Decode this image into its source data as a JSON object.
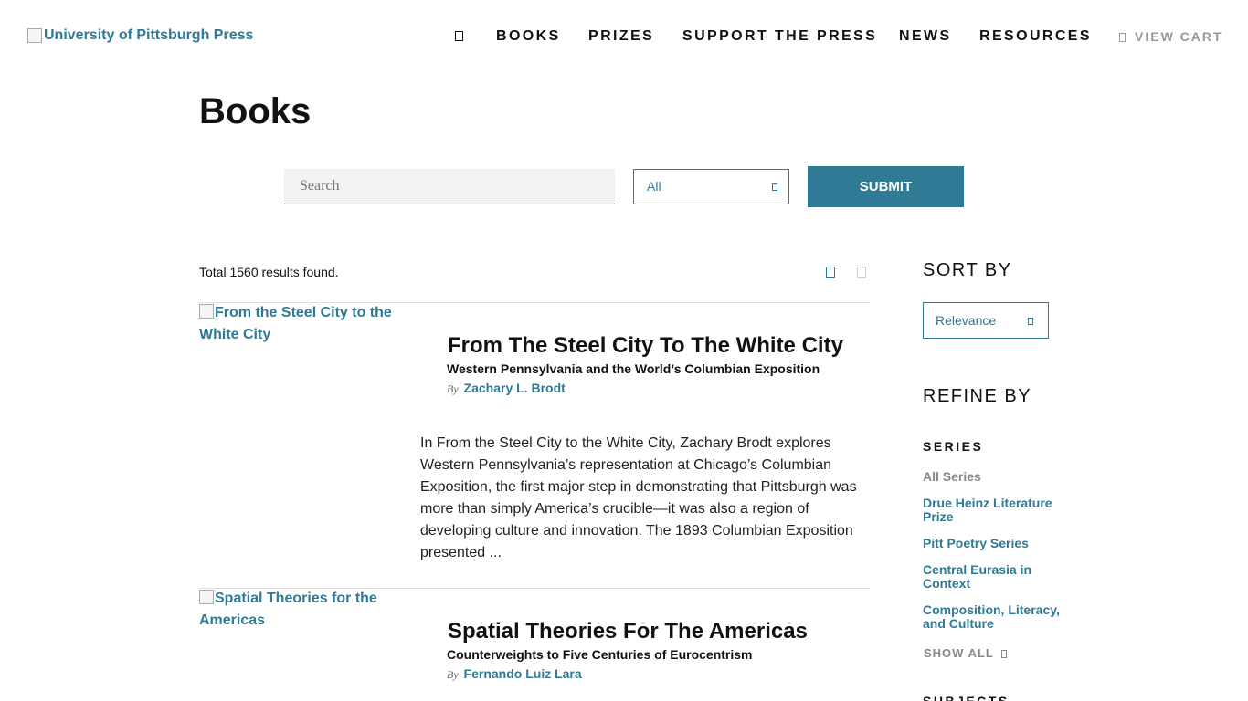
{
  "header": {
    "logo_alt": "University of Pittsburgh Press",
    "nav": {
      "search_icon": "search-icon",
      "items": [
        "Books",
        "Prizes",
        "Support the Press",
        "News",
        "Resources"
      ],
      "cart_label": "View Cart",
      "cart_icon": "cart-icon"
    }
  },
  "page": {
    "title": "Books"
  },
  "search": {
    "placeholder": "Search",
    "value": "",
    "type_select": "All",
    "submit_label": "SUBMIT"
  },
  "results": {
    "total_text": "Total 1560 results found.",
    "view_icons": [
      "list-view-icon",
      "grid-view-icon"
    ],
    "books": [
      {
        "image_alt": "From the Steel City to the White City",
        "title": "From The Steel City To The White City",
        "subtitle": "Western Pennsylvania and the World’s Columbian Exposition",
        "by": "By",
        "author": "Zachary L. Brodt",
        "description": "In From the Steel City to the White City, Zachary Brodt explores Western Pennsylvania’s representation at Chicago’s Columbian Exposition, the first major step in demonstrating that Pittsburgh was more than simply America’s crucible—it was also a region of developing culture and innovation. The 1893 Columbian Exposition presented ..."
      },
      {
        "image_alt": "Spatial Theories for the Americas",
        "title": "Spatial Theories For The Americas",
        "subtitle": "Counterweights to Five Centuries of Eurocentrism",
        "by": "By",
        "author": "Fernando Luiz Lara"
      }
    ]
  },
  "sidebar": {
    "sort_heading": "SORT BY",
    "sort_value": "Relevance",
    "refine_heading": "REFINE BY",
    "series_heading": "SERIES",
    "series": [
      "All Series",
      "Drue Heinz Literature Prize",
      "Pitt Poetry Series",
      "Central Eurasia in Context",
      "Composition, Literacy, and Culture"
    ],
    "show_all_label": "SHOW ALL",
    "subjects_heading": "SUBJECTS"
  },
  "colors": {
    "accent": "#2f7a95",
    "muted": "#888888",
    "text": "#111111"
  }
}
